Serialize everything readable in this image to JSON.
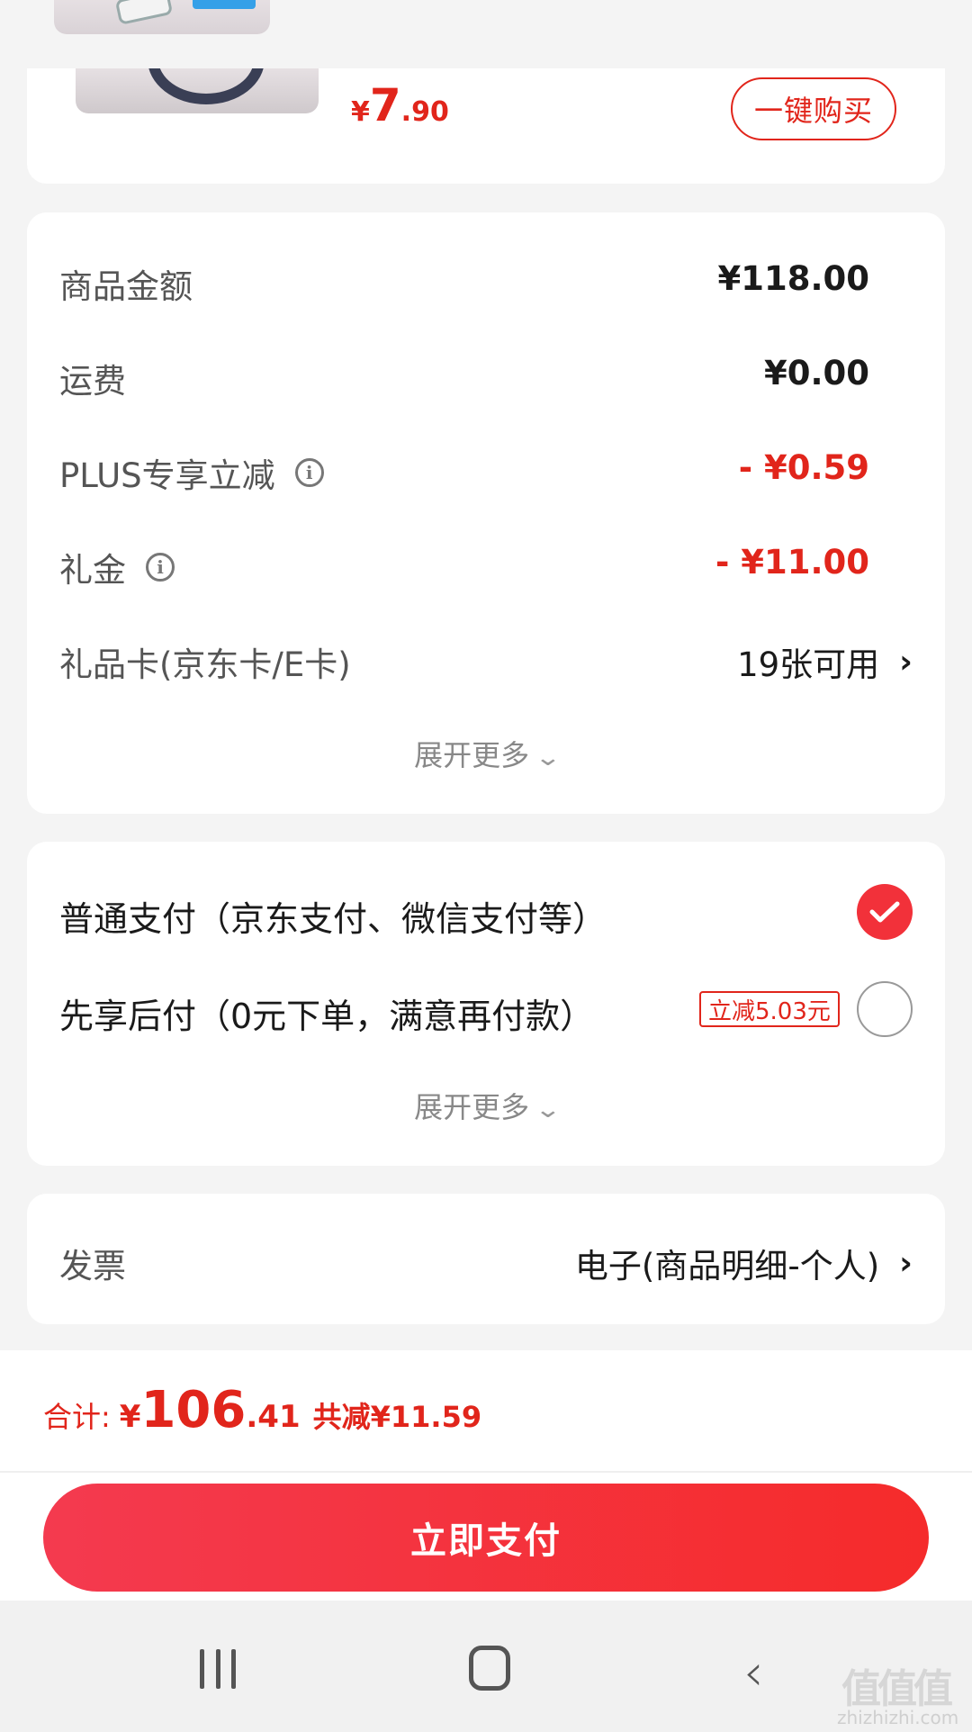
{
  "product": {
    "price_currency": "¥",
    "price_int": "7",
    "price_dec": ".90",
    "buy_button": "一键购买"
  },
  "amounts": {
    "rows": [
      {
        "label": "商品金额",
        "value": "¥118.00"
      },
      {
        "label": "运费",
        "value": "¥0.00"
      },
      {
        "label": "PLUS专享立减",
        "value": "- ¥0.59"
      },
      {
        "label": "礼金",
        "value": "- ¥11.00"
      },
      {
        "label": "礼品卡(京东卡/E卡)",
        "value": "19张可用"
      }
    ],
    "expand_label": "展开更多"
  },
  "payment": {
    "options": [
      {
        "label": "普通支付（京东支付、微信支付等）",
        "selected": true
      },
      {
        "label": "先享后付（0元下单，满意再付款）",
        "selected": false,
        "promo": "立减5.03元"
      }
    ],
    "expand_label": "展开更多"
  },
  "invoice": {
    "label": "发票",
    "value": "电子(商品明细-个人)"
  },
  "total": {
    "label": "合计:",
    "currency": "¥",
    "int": "106",
    "dec": ".41",
    "saved": "共减¥11.59"
  },
  "pay_button": "立即支付",
  "watermark": {
    "logo": "值值值",
    "text": "zhizhizhi.com"
  },
  "colors": {
    "accent": "#e1251b",
    "button_gradient_start": "#f43a4f",
    "button_gradient_end": "#f52b2b"
  }
}
